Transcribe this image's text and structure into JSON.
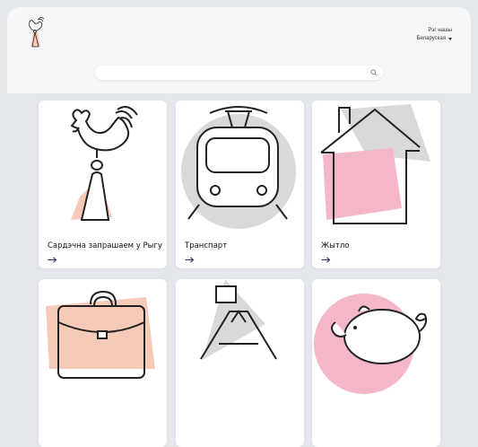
{
  "header": {
    "help_label": "Рэг нашы",
    "language_label": "Беларуская"
  },
  "search": {
    "placeholder": ""
  },
  "cards": [
    {
      "title": "Сардэчна запрашаем у Рыгу"
    },
    {
      "title": "Транспарт"
    },
    {
      "title": "Жытло"
    },
    {
      "title": ""
    },
    {
      "title": ""
    },
    {
      "title": ""
    }
  ],
  "colors": {
    "accent_pink": "#f4b7c8",
    "accent_peach": "#f7c9b8",
    "illustration_gray": "#d9d9d9",
    "arrow": "#2b2f6b"
  },
  "icons": [
    "rooster-logo-icon",
    "search-icon",
    "rooster-icon",
    "tram-icon",
    "house-icon",
    "briefcase-icon",
    "letter-icon",
    "piggy-bank-icon",
    "arrow-right-icon"
  ]
}
